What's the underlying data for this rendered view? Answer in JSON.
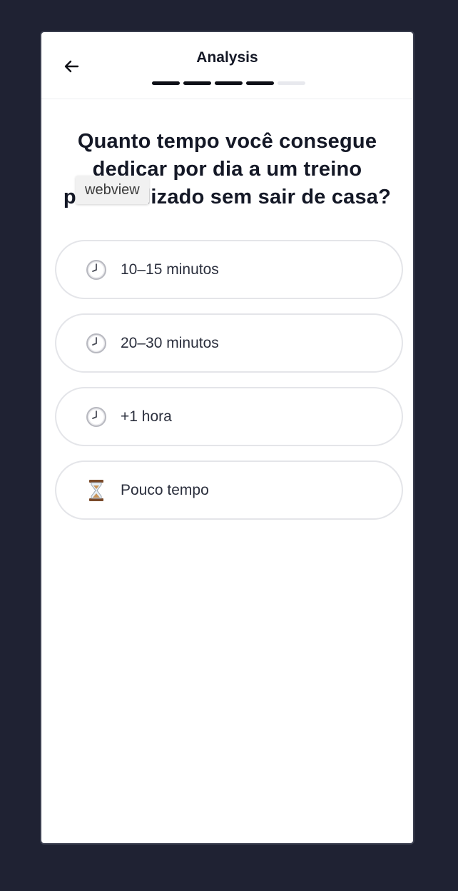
{
  "header": {
    "title": "Analysis",
    "back_icon": "arrow-left-icon",
    "progress": {
      "completed": 4,
      "total": 5
    }
  },
  "tooltip": "webview",
  "question": "Quanto tempo você consegue dedicar por dia a um treino personalizado sem sair de casa?",
  "options": [
    {
      "icon": "clock-icon",
      "label": "10–15 minutos"
    },
    {
      "icon": "clock-icon",
      "label": "20–30 minutos"
    },
    {
      "icon": "clock-icon",
      "label": "+1 hora"
    },
    {
      "icon": "hourglass-icon",
      "label": "Pouco tempo"
    }
  ],
  "colors": {
    "background": "#1f2233",
    "text": "#141826",
    "progress_done": "#0d0f16",
    "progress_todo": "#e8e9ee",
    "option_border": "#e4e5e9"
  }
}
